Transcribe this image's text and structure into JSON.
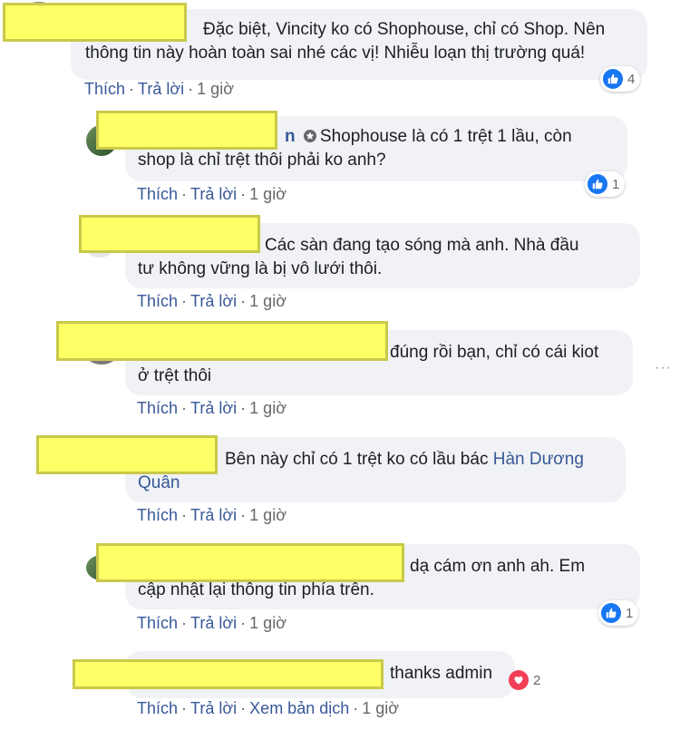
{
  "comments": [
    {
      "text": "Đặc biệt, Vincity ko có Shophouse, chỉ có Shop. Nên thông tin này hoàn toàn sai nhé các vị! Nhiễu loạn thị trường quá!",
      "line1": "Đặc biệt, Vincity ko có Shophouse, chỉ có Shop. Nên",
      "line2": "thông tin này hoàn toàn sai nhé các vị! Nhiễu loạn thị trường quá!",
      "like": "Thích",
      "reply": "Trả lời",
      "time": "1 giờ",
      "reaction_count": "4"
    },
    {
      "name_fragment": "n",
      "line1": "Shophouse là có 1 trệt 1 lầu, còn",
      "line2": "shop là chỉ trệt thôi phải ko anh?",
      "like": "Thích",
      "reply": "Trả lời",
      "time": "1 giờ",
      "reaction_count": "1"
    },
    {
      "line1": "Các sàn đang tạo sóng mà anh. Nhà đầu",
      "line2": "tư không vững là bị vô lưới thôi.",
      "like": "Thích",
      "reply": "Trả lời",
      "time": "1 giờ"
    },
    {
      "line1": "đúng rồi bạn, chỉ có cái kiot",
      "line2": "ở trệt thôi",
      "like": "Thích",
      "reply": "Trả lời",
      "time": "1 giờ"
    },
    {
      "line1_text": "Bên này chỉ có 1 trệt ko có lầu bác ",
      "mention_part1": "Hàn Dương",
      "mention_part2": "Quân",
      "like": "Thích",
      "reply": "Trả lời",
      "time": "1 giờ"
    },
    {
      "line1": "dạ cám ơn anh ah. Em",
      "line2": "cập nhật lại thông tin phía trên.",
      "like": "Thích",
      "reply": "Trả lời",
      "time": "1 giờ",
      "reaction_count": "1"
    },
    {
      "line1": "thanks admin",
      "like": "Thích",
      "reply": "Trả lời",
      "translate": "Xem bản dịch",
      "time": "1 giờ",
      "reaction_count": "2"
    }
  ],
  "more_options": "···",
  "sep": "·",
  "colors": {
    "like_blue": "#1877f2",
    "love_red": "#f33e58",
    "link": "#385898",
    "bubble": "#f0f2f5",
    "mask": "#ffff66"
  }
}
